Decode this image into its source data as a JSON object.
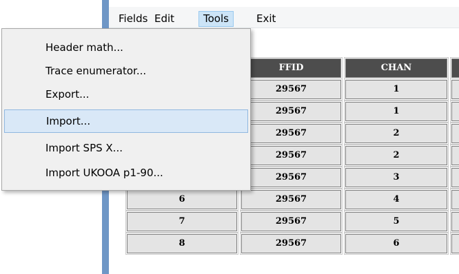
{
  "menubar": {
    "fields": "Fields",
    "edit": "Edit",
    "tools": "Tools",
    "exit": "Exit"
  },
  "tools_menu": {
    "items": [
      {
        "label": "Header math...",
        "highlighted": false
      },
      {
        "label": "Trace enumerator...",
        "highlighted": false
      },
      {
        "label": "Export...",
        "highlighted": false
      },
      {
        "label": "Import...",
        "highlighted": true
      },
      {
        "label": "Import SPS X...",
        "highlighted": false
      },
      {
        "label": "Import UKOOA p1-90...",
        "highlighted": false
      }
    ]
  },
  "table": {
    "headers": [
      "FFID",
      "CHAN"
    ],
    "rows": [
      {
        "index": "",
        "ffid": "29567",
        "chan": "1"
      },
      {
        "index": "",
        "ffid": "29567",
        "chan": "1"
      },
      {
        "index": "",
        "ffid": "29567",
        "chan": "2"
      },
      {
        "index": "",
        "ffid": "29567",
        "chan": "2"
      },
      {
        "index": "",
        "ffid": "29567",
        "chan": "3"
      },
      {
        "index": "6",
        "ffid": "29567",
        "chan": "4"
      },
      {
        "index": "7",
        "ffid": "29567",
        "chan": "5"
      },
      {
        "index": "8",
        "ffid": "29567",
        "chan": "6"
      }
    ]
  },
  "colors": {
    "frame": "#6f97c6",
    "header_bg": "#4d4d4d",
    "cell_bg": "#e4e4e4",
    "menu_highlight": "#d9e8f7",
    "menubar_active": "#cce4f7"
  }
}
